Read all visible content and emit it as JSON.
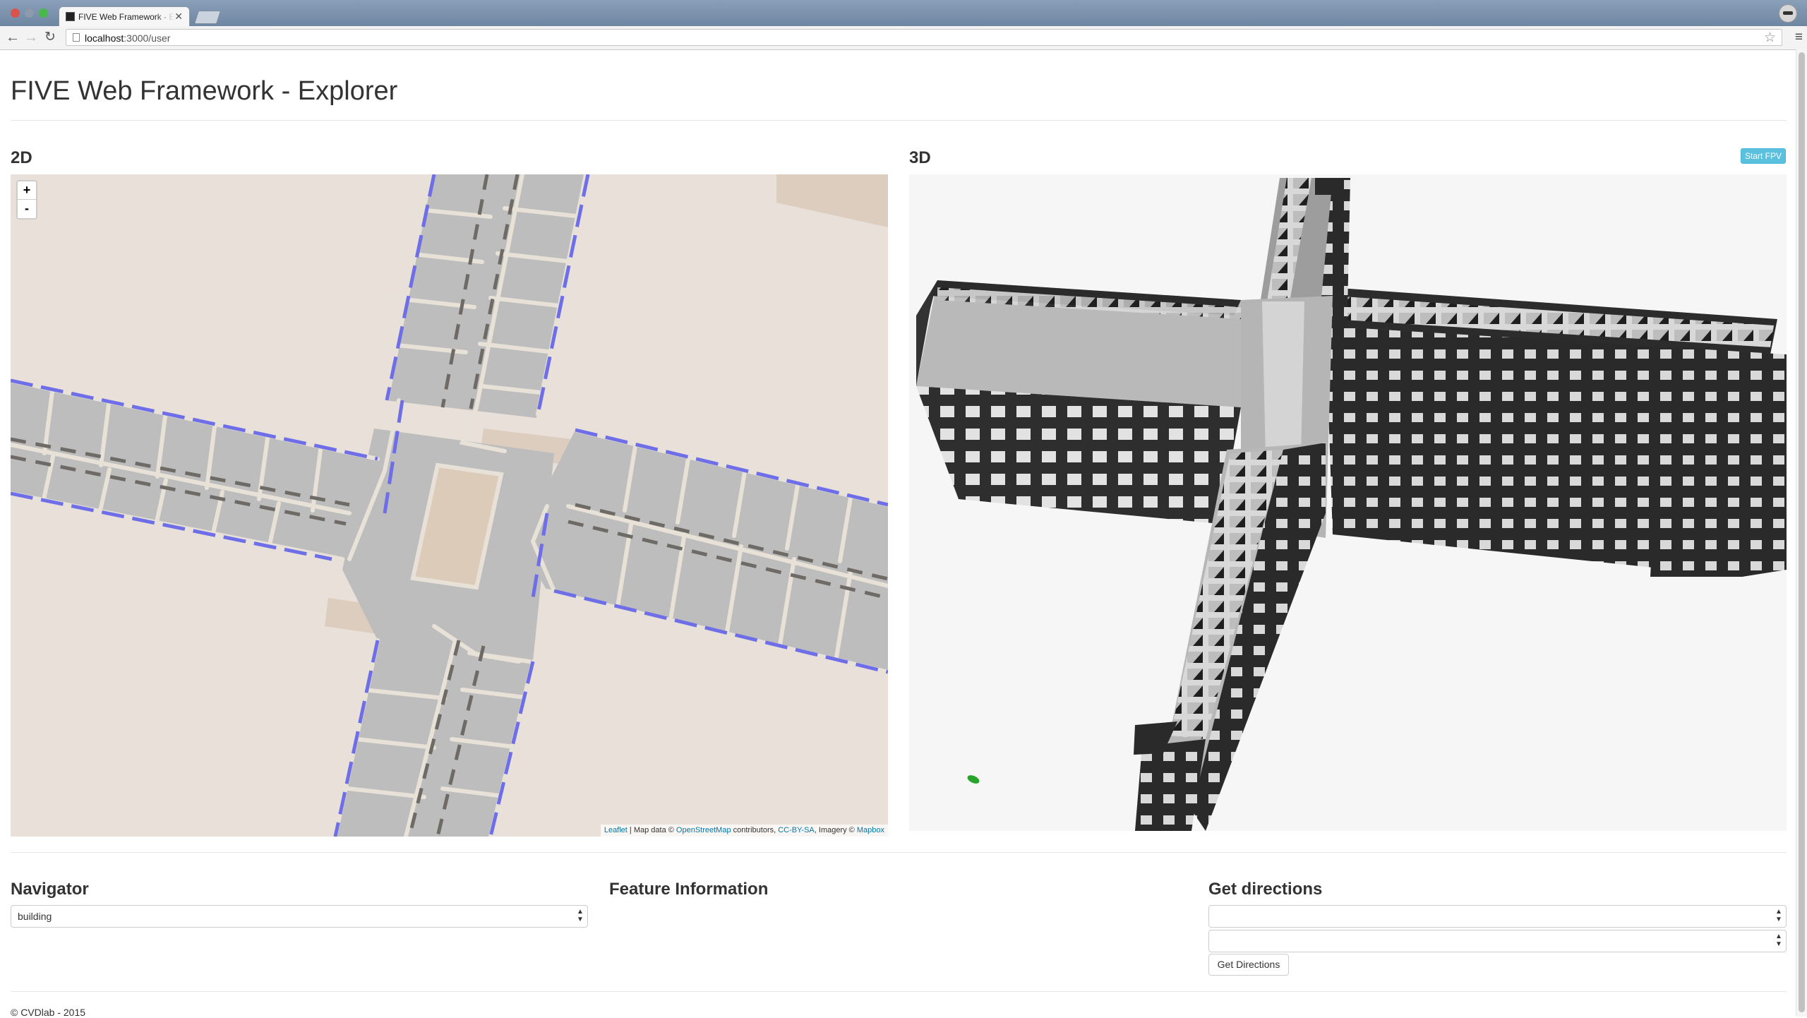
{
  "browser": {
    "tab_title": "FIVE Web Framework - Explorer",
    "url_host": "localhost",
    "url_path": ":3000/user",
    "close_glyph": "✕",
    "back_glyph": "←",
    "forward_glyph": "→",
    "reload_glyph": "↻",
    "star_glyph": "☆",
    "menu_glyph": "≡"
  },
  "header": {
    "title": "FIVE Web Framework - Explorer"
  },
  "panels": {
    "left_title": "2D",
    "right_title": "3D",
    "fpv_button": "Start FPV"
  },
  "map": {
    "zoom_in": "+",
    "zoom_out": "-",
    "attribution": {
      "leaflet": "Leaflet",
      "text1": " | Map data © ",
      "osm": "OpenStreetMap",
      "text2": " contributors, ",
      "license": "CC-BY-SA",
      "text3": ", Imagery © ",
      "mapbox": "Mapbox"
    }
  },
  "navigator": {
    "title": "Navigator",
    "selected": "building",
    "arrow": "▲▼"
  },
  "feature_info": {
    "title": "Feature Information"
  },
  "directions": {
    "title": "Get directions",
    "from_value": "",
    "to_value": "",
    "button": "Get Directions"
  },
  "footer": {
    "text": "© CVDlab - 2015"
  },
  "colors": {
    "accent_info": "#5bc0de",
    "map_background": "#e9e1d9",
    "room_fill": "#bcbcbc",
    "wall_dash": "#6e6ee8",
    "model_background": "#f6f6f6"
  }
}
